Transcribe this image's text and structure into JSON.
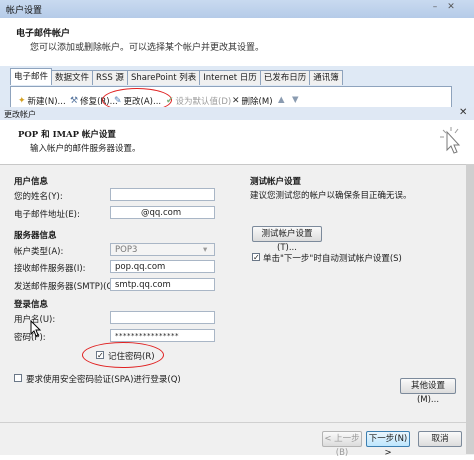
{
  "background_window": {
    "title": "帐户设置",
    "heading": "电子邮件帐户",
    "subtext": "您可以添加或删除帐户。可以选择某个帐户并更改其设置。",
    "tabs": [
      {
        "label": "电子邮件",
        "active": true
      },
      {
        "label": "数据文件",
        "active": false
      },
      {
        "label": "RSS 源",
        "active": false
      },
      {
        "label": "SharePoint 列表",
        "active": false
      },
      {
        "label": "Internet 日历",
        "active": false
      },
      {
        "label": "已发布日历",
        "active": false
      },
      {
        "label": "通讯簿",
        "active": false
      }
    ],
    "toolbar": {
      "new": "新建(N)...",
      "repair": "修复(R)...",
      "change": "更改(A)...",
      "set_default": "设为默认值(D)",
      "remove": "删除(M)"
    }
  },
  "dialog": {
    "title": "更改帐户",
    "heading": "POP 和 IMAP 帐户设置",
    "subheading": "输入帐户的邮件服务器设置。",
    "user_info": {
      "section": "用户信息",
      "name_label": "您的姓名(Y):",
      "name_value": "",
      "email_label": "电子邮件地址(E):",
      "email_value": "@qq.com"
    },
    "server_info": {
      "section": "服务器信息",
      "account_type_label": "帐户类型(A):",
      "account_type_value": "POP3",
      "incoming_label": "接收邮件服务器(I):",
      "incoming_value": "pop.qq.com",
      "outgoing_label": "发送邮件服务器(SMTP)(O):",
      "outgoing_value": "smtp.qq.com"
    },
    "logon_info": {
      "section": "登录信息",
      "username_label": "用户名(U):",
      "username_value": "",
      "password_label": "密码(P):",
      "password_value": "****************",
      "remember_label": "记住密码(R)",
      "remember_checked": true
    },
    "spa_label": "要求使用安全密码验证(SPA)进行登录(Q)",
    "spa_checked": false,
    "test": {
      "section": "测试帐户设置",
      "description": "建议您测试您的帐户以确保条目正确无误。",
      "test_button": "测试帐户设置(T)...",
      "auto_test_label": "单击\"下一步\"时自动测试帐户设置(S)",
      "auto_test_checked": true
    },
    "more_settings": "其他设置(M)...",
    "buttons": {
      "back": "< 上一步(B)",
      "next": "下一步(N) >",
      "cancel": "取消"
    }
  },
  "colors": {
    "annotation": "#e02020",
    "titlebar": "#c9daf0",
    "primary_button": "#bee6fd"
  }
}
